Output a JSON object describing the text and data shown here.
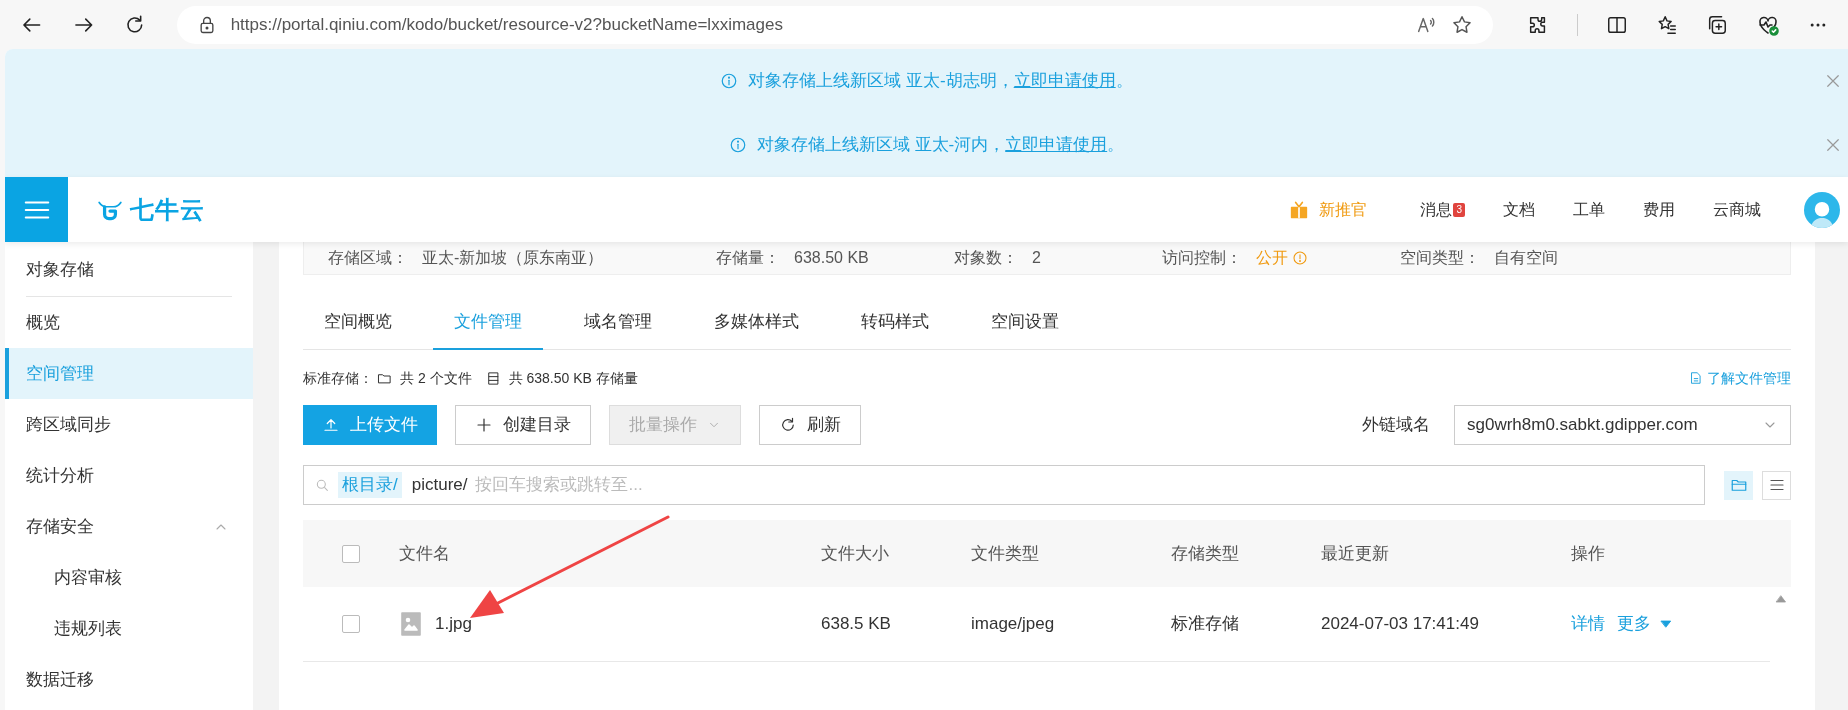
{
  "browser": {
    "url": "https://portal.qiniu.com/kodo/bucket/resource-v2?bucketName=lxximages"
  },
  "banners": [
    {
      "text": "对象存储上线新区域 亚太-胡志明，",
      "link": "立即申请使用",
      "tail": "。"
    },
    {
      "text": "对象存储上线新区域 亚太-河内，",
      "link": "立即申请使用",
      "tail": "。"
    }
  ],
  "header": {
    "logo": "七牛云",
    "promo": "新推官",
    "nav": [
      {
        "label": "消息",
        "badge": "3"
      },
      {
        "label": "文档"
      },
      {
        "label": "工单"
      },
      {
        "label": "费用"
      },
      {
        "label": "云商城"
      }
    ]
  },
  "sidebar": {
    "title": "对象存储",
    "items": [
      {
        "label": "概览",
        "selected": false
      },
      {
        "label": "空间管理",
        "selected": true
      },
      {
        "label": "跨区域同步",
        "selected": false
      },
      {
        "label": "统计分析",
        "selected": false
      },
      {
        "label": "存储安全",
        "selected": false,
        "expanded": true,
        "children": [
          {
            "label": "内容审核",
            "selected": false
          },
          {
            "label": "违规列表",
            "selected": false
          }
        ]
      },
      {
        "label": "数据迁移",
        "selected": false
      }
    ]
  },
  "info": [
    {
      "label": "存储区域：",
      "value": "亚太-新加坡（原东南亚）",
      "kind": "plain"
    },
    {
      "label": "存储量：",
      "value": "638.50 KB",
      "kind": "plain"
    },
    {
      "label": "对象数：",
      "value": "2",
      "kind": "plain"
    },
    {
      "label": "访问控制：",
      "value": "公开",
      "kind": "warning"
    },
    {
      "label": "空间类型：",
      "value": "自有空间",
      "kind": "plain"
    }
  ],
  "tabs": [
    {
      "label": "空间概览",
      "selected": false
    },
    {
      "label": "文件管理",
      "selected": true
    },
    {
      "label": "域名管理",
      "selected": false
    },
    {
      "label": "多媒体样式",
      "selected": false
    },
    {
      "label": "转码样式",
      "selected": false
    },
    {
      "label": "空间设置",
      "selected": false
    }
  ],
  "stats": {
    "label": "标准存储：",
    "files": "共 2 个文件",
    "size": "共 638.50 KB 存储量",
    "help": "了解文件管理"
  },
  "toolbar": [
    {
      "label": "上传文件",
      "kind": "upload",
      "disabled": false
    },
    {
      "label": "创建目录",
      "kind": "create",
      "disabled": false
    },
    {
      "label": "批量操作",
      "kind": "batch",
      "disabled": true
    },
    {
      "label": "刷新",
      "kind": "refresh",
      "disabled": false
    }
  ],
  "domain": {
    "label": "外链域名",
    "value": "sg0wrh8m0.sabkt.gdipper.com"
  },
  "path": {
    "root": "根目录/",
    "folder": "picture/",
    "placeholder": "按回车搜索或跳转至..."
  },
  "views": [
    {
      "kind": "folder",
      "selected": true
    },
    {
      "kind": "list",
      "selected": false
    }
  ],
  "table": {
    "checked": false,
    "columns": [
      "文件名",
      "文件大小",
      "文件类型",
      "存储类型",
      "最近更新",
      "操作"
    ],
    "rows": [
      {
        "checked": false,
        "name": "1.jpg",
        "size": "638.5 KB",
        "type": "image/jpeg",
        "storage": "标准存储",
        "updated": "2024-07-03 17:41:49",
        "actions": [
          "详情",
          "更多"
        ]
      }
    ]
  }
}
